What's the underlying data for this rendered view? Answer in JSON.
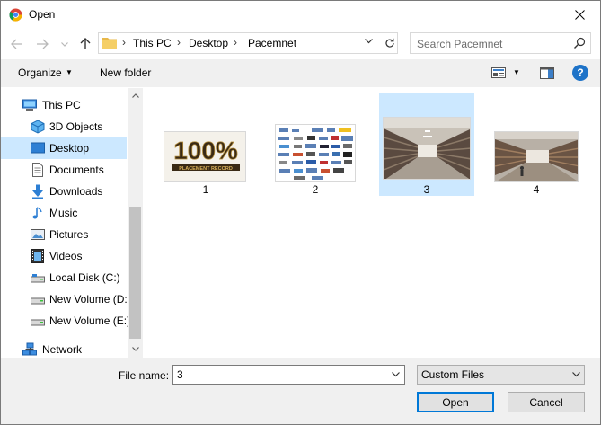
{
  "window": {
    "title": "Open"
  },
  "nav": {
    "breadcrumbs": [
      "This PC",
      "Desktop",
      "Pacemnet"
    ],
    "search_placeholder": "Search Pacemnet"
  },
  "toolbar": {
    "organize": "Organize",
    "new_folder": "New folder"
  },
  "sidebar": {
    "items": [
      {
        "label": "This PC",
        "icon": "pc-icon"
      },
      {
        "label": "3D Objects",
        "icon": "3d-objects-icon"
      },
      {
        "label": "Desktop",
        "icon": "desktop-icon",
        "selected": true
      },
      {
        "label": "Documents",
        "icon": "documents-icon"
      },
      {
        "label": "Downloads",
        "icon": "downloads-icon"
      },
      {
        "label": "Music",
        "icon": "music-icon"
      },
      {
        "label": "Pictures",
        "icon": "pictures-icon"
      },
      {
        "label": "Videos",
        "icon": "videos-icon"
      },
      {
        "label": "Local Disk (C:)",
        "icon": "disk-icon"
      },
      {
        "label": "New Volume (D:",
        "icon": "disk-icon"
      },
      {
        "label": "New Volume (E:)",
        "icon": "disk-icon"
      },
      {
        "label": "Network",
        "icon": "network-icon"
      }
    ]
  },
  "files": [
    {
      "name": "1",
      "thumb_text": "100%",
      "thumb_sub": "PLACEMENT RECORD"
    },
    {
      "name": "2"
    },
    {
      "name": "3",
      "selected": true
    },
    {
      "name": "4"
    }
  ],
  "bottom": {
    "file_name_label": "File name:",
    "file_name_value": "3",
    "filter_value": "Custom Files",
    "open_label": "Open",
    "cancel_label": "Cancel"
  },
  "colors": {
    "selection": "#cce8ff",
    "accent": "#0078d7",
    "help": "#1e73c8"
  }
}
